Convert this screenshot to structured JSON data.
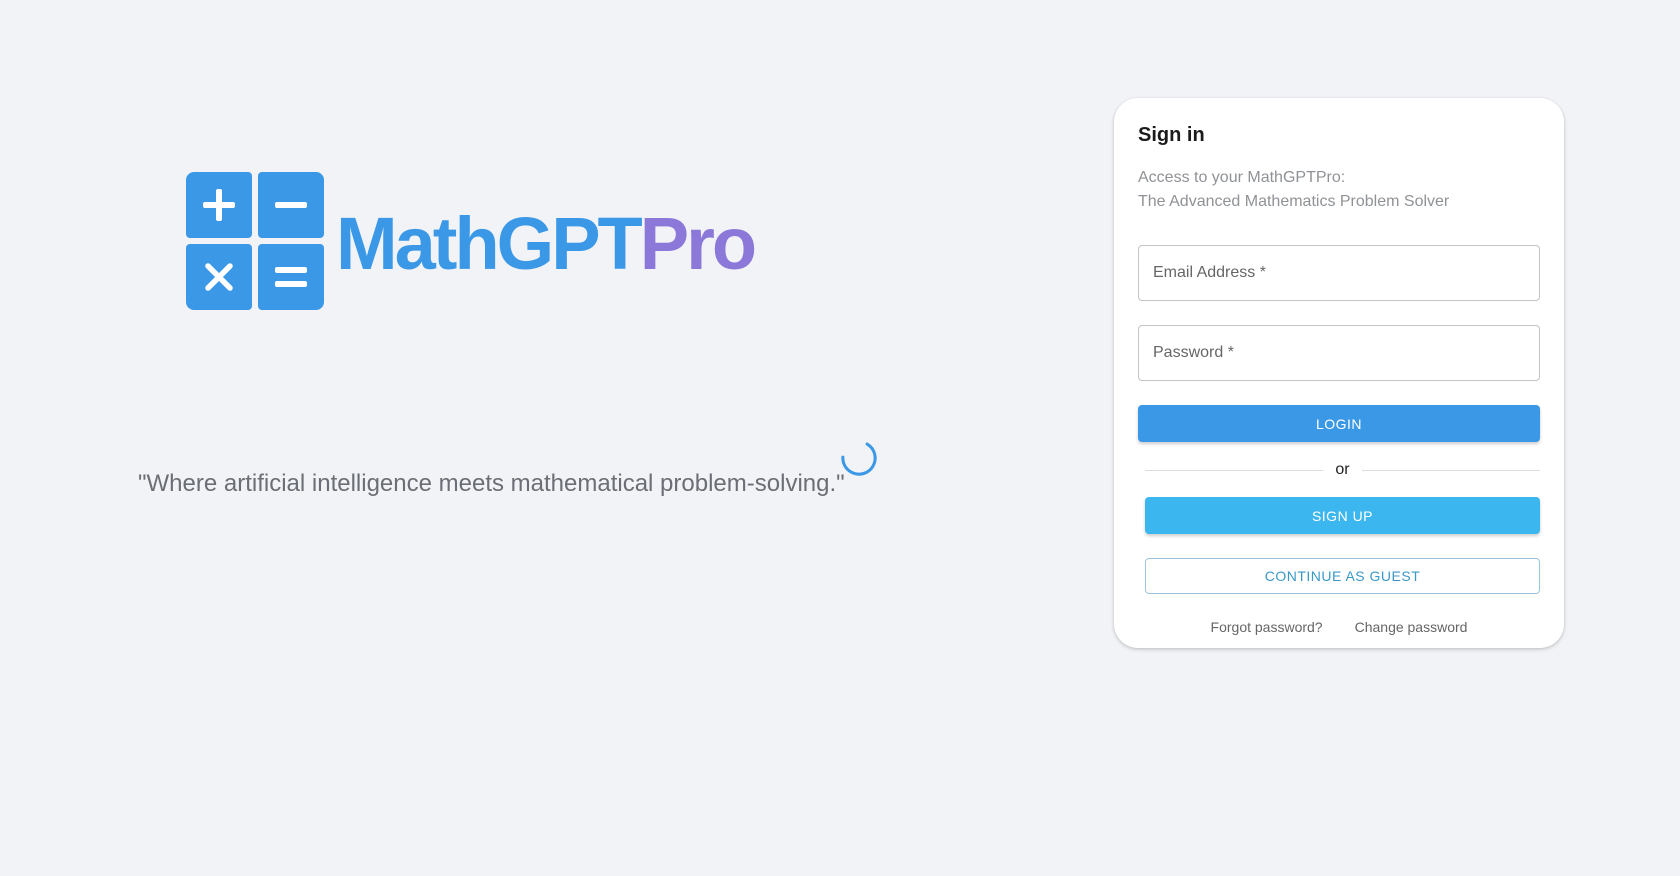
{
  "brand": {
    "name_part1": "MathGPT",
    "name_part2": "Pro",
    "primary_color": "#3a98e6",
    "secondary_color": "#8c78d8",
    "logo_icons": [
      "plus-icon",
      "minus-icon",
      "times-icon",
      "equals-icon"
    ]
  },
  "tagline": "\"Where artificial intelligence meets mathematical problem-solving.\"",
  "signin": {
    "title": "Sign in",
    "subtitle_line1": "Access to your MathGPTPro:",
    "subtitle_line2": "The Advanced Mathematics Problem Solver",
    "email_placeholder": "Email Address *",
    "password_placeholder": "Password *",
    "login_label": "LOGIN",
    "divider_text": "or",
    "signup_label": "SIGN UP",
    "guest_label": "CONTINUE AS GUEST",
    "forgot_label": "Forgot password?",
    "change_label": "Change password"
  },
  "colors": {
    "login_button": "#3a98e6",
    "signup_button": "#3bb6ee",
    "background": "#f1f3f6"
  }
}
